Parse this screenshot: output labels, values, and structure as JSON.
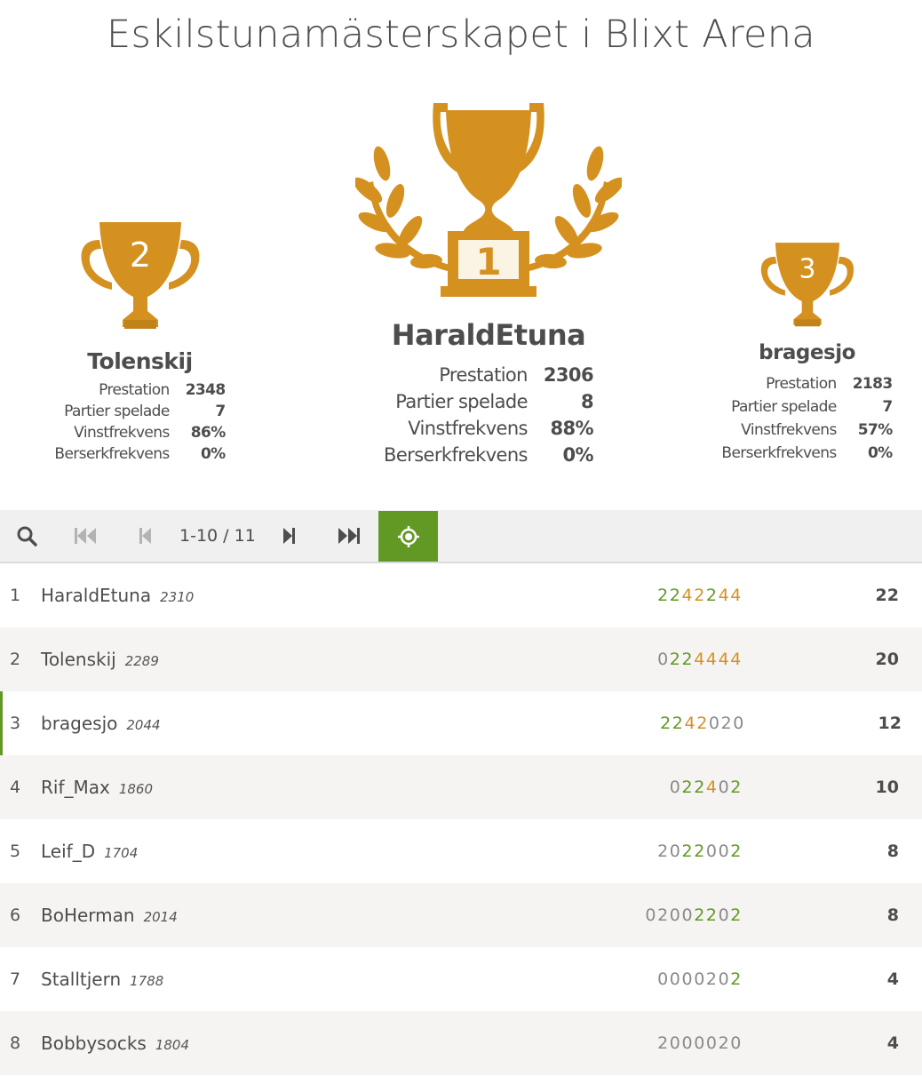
{
  "title": "Eskilstunamästerskapet i Blixt Arena",
  "colors": {
    "gold": "#d59120",
    "win": "#629924",
    "streak": "#d59120",
    "loss": "#8a8a8a",
    "me": "#629924"
  },
  "podium": {
    "first": {
      "place": "1",
      "name": "HaraldEtuna",
      "stats": [
        {
          "label": "Prestation",
          "value": "2306"
        },
        {
          "label": "Partier spelade",
          "value": "8"
        },
        {
          "label": "Vinstfrekvens",
          "value": "88%"
        },
        {
          "label": "Berserkfrekvens",
          "value": "0%"
        }
      ]
    },
    "second": {
      "place": "2",
      "name": "Tolenskij",
      "stats": [
        {
          "label": "Prestation",
          "value": "2348"
        },
        {
          "label": "Partier spelade",
          "value": "7"
        },
        {
          "label": "Vinstfrekvens",
          "value": "86%"
        },
        {
          "label": "Berserkfrekvens",
          "value": "0%"
        }
      ]
    },
    "third": {
      "place": "3",
      "name": "bragesjo",
      "stats": [
        {
          "label": "Prestation",
          "value": "2183"
        },
        {
          "label": "Partier spelade",
          "value": "7"
        },
        {
          "label": "Vinstfrekvens",
          "value": "57%"
        },
        {
          "label": "Berserkfrekvens",
          "value": "0%"
        }
      ]
    }
  },
  "pager": {
    "page_info": "1-10 / 11",
    "icons": [
      "search-icon",
      "first-page-icon",
      "prev-page-icon",
      "next-page-icon",
      "last-page-icon",
      "target-icon"
    ]
  },
  "standings": [
    {
      "rank": "1",
      "name": "HaraldEtuna",
      "rating": "2310",
      "sheet": [
        [
          "2",
          "w"
        ],
        [
          "2",
          "w"
        ],
        [
          "4",
          "s"
        ],
        [
          "2",
          "s"
        ],
        [
          "2",
          "w"
        ],
        [
          "4",
          "s"
        ],
        [
          "4",
          "s"
        ]
      ],
      "score": "22"
    },
    {
      "rank": "2",
      "name": "Tolenskij",
      "rating": "2289",
      "sheet": [
        [
          "0",
          "l"
        ],
        [
          "2",
          "w"
        ],
        [
          "2",
          "w"
        ],
        [
          "4",
          "s"
        ],
        [
          "4",
          "s"
        ],
        [
          "4",
          "s"
        ],
        [
          "4",
          "s"
        ]
      ],
      "score": "20"
    },
    {
      "rank": "3",
      "name": "bragesjo",
      "rating": "2044",
      "sheet": [
        [
          "2",
          "w"
        ],
        [
          "2",
          "w"
        ],
        [
          "4",
          "s"
        ],
        [
          "2",
          "s"
        ],
        [
          "0",
          "l"
        ],
        [
          "2",
          "l"
        ],
        [
          "0",
          "l"
        ]
      ],
      "score": "12",
      "me": true
    },
    {
      "rank": "4",
      "name": "Rif_Max",
      "rating": "1860",
      "sheet": [
        [
          "0",
          "l"
        ],
        [
          "2",
          "w"
        ],
        [
          "2",
          "w"
        ],
        [
          "4",
          "s"
        ],
        [
          "0",
          "l"
        ],
        [
          "2",
          "w"
        ]
      ],
      "score": "10"
    },
    {
      "rank": "5",
      "name": "Leif_D",
      "rating": "1704",
      "sheet": [
        [
          "2",
          "l"
        ],
        [
          "0",
          "l"
        ],
        [
          "2",
          "w"
        ],
        [
          "2",
          "w"
        ],
        [
          "0",
          "l"
        ],
        [
          "0",
          "l"
        ],
        [
          "2",
          "w"
        ]
      ],
      "score": "8"
    },
    {
      "rank": "6",
      "name": "BoHerman",
      "rating": "2014",
      "sheet": [
        [
          "0",
          "l"
        ],
        [
          "2",
          "l"
        ],
        [
          "0",
          "l"
        ],
        [
          "0",
          "l"
        ],
        [
          "2",
          "w"
        ],
        [
          "2",
          "w"
        ],
        [
          "0",
          "l"
        ],
        [
          "2",
          "w"
        ]
      ],
      "score": "8"
    },
    {
      "rank": "7",
      "name": "Stalltjern",
      "rating": "1788",
      "sheet": [
        [
          "0",
          "l"
        ],
        [
          "0",
          "l"
        ],
        [
          "0",
          "l"
        ],
        [
          "0",
          "l"
        ],
        [
          "2",
          "l"
        ],
        [
          "0",
          "l"
        ],
        [
          "2",
          "w"
        ]
      ],
      "score": "4"
    },
    {
      "rank": "8",
      "name": "Bobbysocks",
      "rating": "1804",
      "sheet": [
        [
          "2",
          "l"
        ],
        [
          "0",
          "l"
        ],
        [
          "0",
          "l"
        ],
        [
          "0",
          "l"
        ],
        [
          "0",
          "l"
        ],
        [
          "2",
          "l"
        ],
        [
          "0",
          "l"
        ]
      ],
      "score": "4"
    }
  ]
}
